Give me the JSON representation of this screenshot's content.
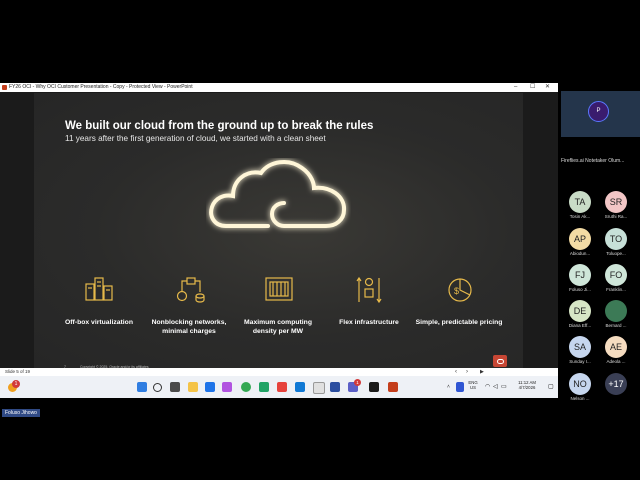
{
  "window": {
    "title": "FY26 OCI - Why OCI Customer Presentation - Copy  -  Protected View  -  PowerPoint",
    "min": "–",
    "max": "☐",
    "close": "✕"
  },
  "slide": {
    "title": "We built our cloud from the ground up to break the rules",
    "subtitle": "11 years after the first generation of cloud, we started with a clean sheet",
    "features": [
      {
        "icon": "servers-icon",
        "label": "Off-box virtualization"
      },
      {
        "icon": "network-icon",
        "label": "Nonblocking networks, minimal charges"
      },
      {
        "icon": "compute-chip-icon",
        "label": "Maximum computing density per MW"
      },
      {
        "icon": "flex-arrows-icon",
        "label": "Flex infrastructure"
      },
      {
        "icon": "pricing-pie-icon",
        "label": "Simple, predictable pricing"
      }
    ],
    "copyright": "Copyright © 2025, Oracle and/or its affiliates",
    "page_num": "7",
    "accent": "#c74634"
  },
  "status_bar": {
    "slide_info": "Slide 5 of 19"
  },
  "taskbar": {
    "lang": "ENG",
    "region": "US",
    "time": "11:12 AM",
    "date": "4/7/2026",
    "notif_badge": "1",
    "teams_badge": "1"
  },
  "participants": {
    "self_initial": "P",
    "firefly_name": "Fireflies.ai Notetaker Olum...",
    "list": [
      {
        "initials": "TA",
        "name": "Tosin Ak...",
        "color": "#c9dcc7"
      },
      {
        "initials": "SR",
        "name": "Sruthi Ra...",
        "color": "#f2c6c6"
      },
      {
        "initials": "AP",
        "name": "Abiodun...",
        "color": "#f3dba4"
      },
      {
        "initials": "TO",
        "name": "Toluope...",
        "color": "#c7e0d8"
      },
      {
        "initials": "FJ",
        "name": "Foluso Ji...",
        "color": "#cfe6d9"
      },
      {
        "initials": "FO",
        "name": "Franklin...",
        "color": "#cfe6d9"
      },
      {
        "initials": "DE",
        "name": "Diana Eff...",
        "color": "#d7e6c6"
      },
      {
        "initials": "",
        "name": "Bernard ...",
        "color": "#3c7a56"
      },
      {
        "initials": "SA",
        "name": "Sunday I...",
        "color": "#c6d6ee"
      },
      {
        "initials": "AE",
        "name": "Adeola ...",
        "color": "#f5dcc0"
      },
      {
        "initials": "NO",
        "name": "Nelson ...",
        "color": "#c6d6ee"
      },
      {
        "initials": "+17",
        "name": "",
        "color": "#3a3f55"
      }
    ]
  },
  "active_speaker": "Foluso Jihowo"
}
